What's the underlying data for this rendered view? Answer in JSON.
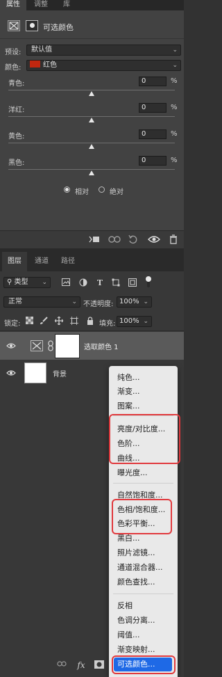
{
  "properties_panel": {
    "tabs": [
      {
        "label": "属性",
        "active": true
      },
      {
        "label": "调整",
        "active": false
      },
      {
        "label": "库",
        "active": false
      }
    ],
    "header_title": "可选颜色",
    "preset": {
      "label": "预设:",
      "value": "默认值"
    },
    "colors": {
      "label": "颜色:",
      "value": "红色",
      "swatch_color": "#c0270f"
    },
    "sliders": [
      {
        "label": "青色:",
        "value": "0",
        "unit": "%"
      },
      {
        "label": "洋红:",
        "value": "0",
        "unit": "%"
      },
      {
        "label": "黄色:",
        "value": "0",
        "unit": "%"
      },
      {
        "label": "黑色:",
        "value": "0",
        "unit": "%"
      }
    ],
    "method": {
      "relative_label": "相对",
      "absolute_label": "绝对",
      "selected": "相对"
    }
  },
  "layers_panel": {
    "tabs": [
      {
        "label": "图层",
        "active": true
      },
      {
        "label": "通道",
        "active": false
      },
      {
        "label": "路径",
        "active": false
      }
    ],
    "filter": {
      "value": "类型"
    },
    "blend_mode": "正常",
    "opacity": {
      "label": "不透明度:",
      "value": "100%"
    },
    "lock_label": "锁定:",
    "fill": {
      "label": "填充:",
      "value": "100%"
    },
    "layers": [
      {
        "name": "选取颜色 1",
        "selected": true
      },
      {
        "name": "背景",
        "selected": false
      }
    ]
  },
  "adjustment_menu": {
    "items": [
      "纯色...",
      "渐变...",
      "图案...",
      "亮度/对比度...",
      "色阶...",
      "曲线...",
      "曝光度...",
      "自然饱和度...",
      "色相/饱和度...",
      "色彩平衡...",
      "黑白...",
      "照片滤镜...",
      "通道混合器...",
      "颜色查找...",
      "反相",
      "色调分离...",
      "阈值...",
      "渐变映射...",
      "可选颜色..."
    ],
    "selected": "可选颜色...",
    "highlight_color": "#1e69e6",
    "annotation_color": "#e1393d"
  }
}
